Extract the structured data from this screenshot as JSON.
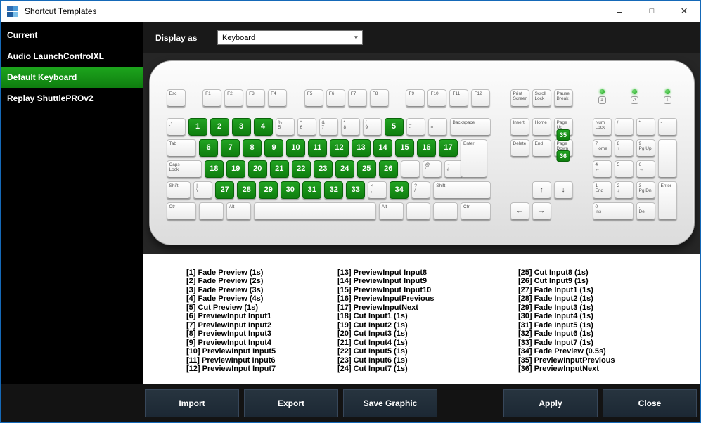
{
  "window": {
    "title": "Shortcut Templates",
    "controls": {
      "minimize": "–",
      "maximize": "□",
      "close": "×"
    }
  },
  "sidebar": {
    "items": [
      {
        "label": "Current",
        "selected": false
      },
      {
        "label": "Audio LaunchControlXL",
        "selected": false
      },
      {
        "label": "Default Keyboard",
        "selected": true
      },
      {
        "label": "Replay ShuttlePROv2",
        "selected": false
      }
    ]
  },
  "toolbar": {
    "display_as_label": "Display as",
    "display_as_value": "Keyboard"
  },
  "keyboard": {
    "esc": "Esc",
    "fgroups": [
      [
        "F1",
        "F2",
        "F3",
        "F4"
      ],
      [
        "F5",
        "F6",
        "F7",
        "F8"
      ],
      [
        "F9",
        "F10",
        "F11",
        "F12"
      ]
    ],
    "main_rows": [
      [
        {
          "l": "¬\n`"
        },
        {
          "g": "1"
        },
        {
          "g": "2"
        },
        {
          "g": "3"
        },
        {
          "g": "4"
        },
        {
          "l": "%\n5"
        },
        {
          "l": "^\n6"
        },
        {
          "l": "&\n7"
        },
        {
          "l": "*\n8"
        },
        {
          "l": "(\n9"
        },
        {
          "g": "5"
        },
        {
          "l": "_\n-"
        },
        {
          "l": "+\n="
        },
        {
          "l": "Backspace",
          "w": 2,
          "n": "backspace"
        }
      ],
      [
        {
          "l": "Tab",
          "w": 1.5
        },
        {
          "g": "6"
        },
        {
          "g": "7"
        },
        {
          "g": "8"
        },
        {
          "g": "9"
        },
        {
          "g": "10"
        },
        {
          "g": "11"
        },
        {
          "g": "12"
        },
        {
          "g": "13"
        },
        {
          "g": "14"
        },
        {
          "g": "15"
        },
        {
          "g": "16"
        },
        {
          "g": "17"
        },
        {
          "l": "Enter",
          "w": 1.35,
          "tall": true,
          "n": "enter"
        }
      ],
      [
        {
          "l": "Caps\nLock",
          "w": 1.75,
          "n": "caps-lock"
        },
        {
          "g": "18"
        },
        {
          "g": "19"
        },
        {
          "g": "20"
        },
        {
          "g": "21"
        },
        {
          "g": "22"
        },
        {
          "g": "23"
        },
        {
          "g": "24"
        },
        {
          "g": "25"
        },
        {
          "g": "26"
        },
        {
          "l": ":\n;"
        },
        {
          "l": "@\n'"
        },
        {
          "l": "~\n#"
        }
      ],
      [
        {
          "l": "Shift",
          "w": 1.25,
          "n": "left-shift"
        },
        {
          "l": "|\n\\"
        },
        {
          "g": "27"
        },
        {
          "g": "28"
        },
        {
          "g": "29"
        },
        {
          "g": "30"
        },
        {
          "g": "31"
        },
        {
          "g": "32"
        },
        {
          "g": "33"
        },
        {
          "l": "<\n,"
        },
        {
          "g": "34"
        },
        {
          "l": "?\n/"
        },
        {
          "l": "Shift",
          "w": 2.75,
          "n": "right-shift"
        }
      ],
      [
        {
          "l": "Ctr",
          "w": 1.5,
          "n": "left-ctrl"
        },
        {
          "l": "",
          "w": 1.25,
          "n": "left-win"
        },
        {
          "l": "Alt",
          "w": 1.25,
          "n": "left-alt"
        },
        {
          "l": "",
          "w": 5.75,
          "n": "space"
        },
        {
          "l": "Alt",
          "w": 1.25,
          "n": "right-alt"
        },
        {
          "l": "",
          "w": 1.25,
          "n": "right-win"
        },
        {
          "l": "",
          "w": 1.25,
          "n": "menu"
        },
        {
          "l": "Ctr",
          "w": 1.5,
          "n": "right-ctrl"
        }
      ]
    ],
    "nav_top": [
      "Print\nScreen",
      "Scroll\nLock",
      "Pause\nBreak"
    ],
    "nav_block": [
      {
        "l": "Insert"
      },
      {
        "l": "Home"
      },
      {
        "l": "Page\nUp",
        "g": "35",
        "n": "page-up"
      },
      {
        "l": "Delete"
      },
      {
        "l": "End"
      },
      {
        "l": "Page\nDown",
        "g": "36",
        "n": "page-down"
      }
    ],
    "arrows": {
      "up": "↑",
      "left": "←",
      "down": "↓",
      "right": "→"
    },
    "indicators": [
      {
        "glyph": "1",
        "name": "num-lock-indicator"
      },
      {
        "glyph": "A",
        "name": "caps-lock-indicator"
      },
      {
        "glyph": "⇩",
        "name": "scroll-lock-indicator"
      }
    ],
    "numpad": [
      {
        "l": "Num\nLock",
        "n": "num-lock"
      },
      {
        "l": "/"
      },
      {
        "l": "*"
      },
      {
        "l": "-"
      },
      {
        "l": "7\nHome"
      },
      {
        "l": "8\n↑"
      },
      {
        "l": "9\nPg Up"
      },
      {
        "l": "+",
        "rs": 2,
        "n": "numpad-plus"
      },
      {
        "l": "4\n←"
      },
      {
        "l": "5"
      },
      {
        "l": "6\n→"
      },
      {
        "l": "1\nEnd"
      },
      {
        "l": "2\n↓"
      },
      {
        "l": "3\nPg Dn"
      },
      {
        "l": "Enter",
        "rs": 2,
        "n": "numpad-enter"
      },
      {
        "l": "0\nIns",
        "cs": 2,
        "n": "numpad-0"
      },
      {
        "l": ".\nDel",
        "n": "numpad-decimal"
      }
    ]
  },
  "shortcuts": {
    "columns": [
      [
        "[1] Fade Preview (1s)",
        "[2] Fade Preview (2s)",
        "[3] Fade Preview (3s)",
        "[4] Fade Preview (4s)",
        "[5] Cut Preview (1s)",
        "[6] PreviewInput Input1",
        "[7] PreviewInput Input2",
        "[8] PreviewInput Input3",
        "[9] PreviewInput Input4",
        "[10] PreviewInput Input5",
        "[11] PreviewInput Input6",
        "[12] PreviewInput Input7"
      ],
      [
        "[13] PreviewInput Input8",
        "[14] PreviewInput Input9",
        "[15] PreviewInput Input10",
        "[16] PreviewInputPrevious",
        "[17] PreviewInputNext",
        "[18] Cut Input1 (1s)",
        "[19] Cut Input2 (1s)",
        "[20] Cut Input3 (1s)",
        "[21] Cut Input4 (1s)",
        "[22] Cut Input5 (1s)",
        "[23] Cut Input6 (1s)",
        "[24] Cut Input7 (1s)"
      ],
      [
        "[25] Cut Input8 (1s)",
        "[26] Cut Input9 (1s)",
        "[27] Fade Input1 (1s)",
        "[28] Fade Input2 (1s)",
        "[29] Fade Input3 (1s)",
        "[30] Fade Input4 (1s)",
        "[31] Fade Input5 (1s)",
        "[32] Fade Input6 (1s)",
        "[33] Fade Input7 (1s)",
        "[34] Fade Preview (0.5s)",
        "[35] PreviewInputPrevious",
        "[36] PreviewInputNext"
      ]
    ]
  },
  "footer": {
    "left": [
      "Import",
      "Export",
      "Save Graphic"
    ],
    "right": [
      "Apply",
      "Close"
    ]
  },
  "colors": {
    "accent_green": "#0f7e0f",
    "window_border": "#1569b8",
    "panel_dark": "#262626",
    "button_face": "#1c2834"
  }
}
